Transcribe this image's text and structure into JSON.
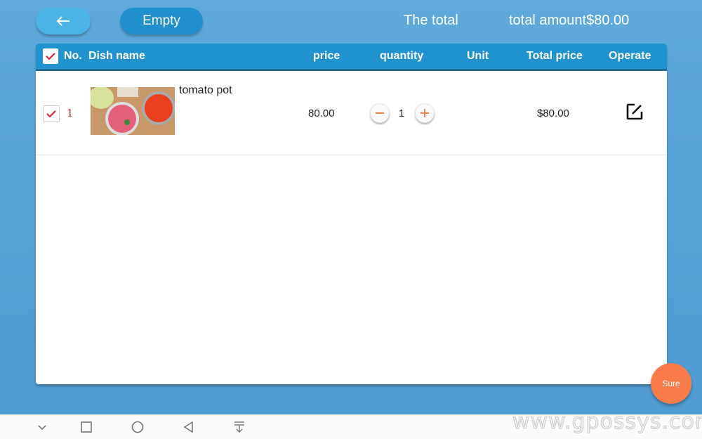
{
  "header": {
    "back_icon": "arrow-left-icon",
    "empty_label": "Empty",
    "total_label": "The total",
    "total_amount": "total amount$80.00"
  },
  "table": {
    "columns": [
      "No.",
      "Dish name",
      "price",
      "quantity",
      "Unit",
      "Total price",
      "Operate"
    ],
    "select_all_checked": true,
    "rows": [
      {
        "checked": true,
        "no": "1",
        "dish_name": "tomato pot",
        "image": "tomato hotpot with sliced meat",
        "price": "80.00",
        "quantity": "1",
        "unit": "",
        "total_price": "$80.00",
        "operate_icon": "edit-icon"
      }
    ]
  },
  "sure_label": "Sure",
  "navbar": {
    "icons": [
      "chevron-down-icon",
      "square-icon",
      "circle-icon",
      "back-triangle-icon",
      "pull-down-icon"
    ]
  },
  "watermark": "www.gpossys.com"
}
